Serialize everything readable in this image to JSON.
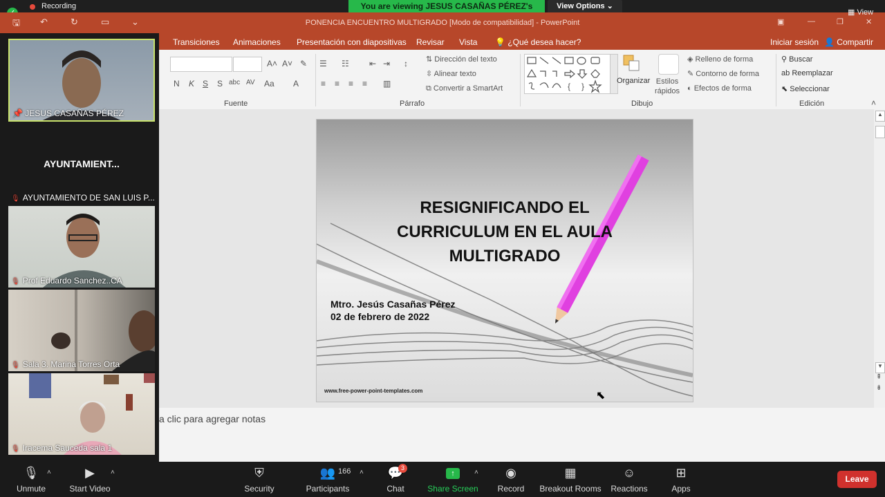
{
  "zoom": {
    "recording_label": "Recording",
    "viewing_banner": "You are viewing JESUS CASAÑAS PÉREZ's screen",
    "view_options": "View Options",
    "view_button": "View",
    "participants": [
      {
        "name": "JESUS CASAÑAS PÉREZ",
        "pinned": true
      },
      {
        "name": "AYUNTAMIENTO DE SAN LUIS P...",
        "center_label": "AYUNTAMIENT..."
      },
      {
        "name": "Prof Eduardo Sanchez..CA"
      },
      {
        "name": "Sala 3. Marina Torres Orta"
      },
      {
        "name": "Iracema Sauceda sala 1"
      }
    ],
    "toolbar": {
      "unmute": "Unmute",
      "start_video": "Start Video",
      "security": "Security",
      "participants": "Participants",
      "participants_count": "166",
      "chat": "Chat",
      "chat_badge": "3",
      "share_screen": "Share Screen",
      "record": "Record",
      "breakout_rooms": "Breakout Rooms",
      "reactions": "Reactions",
      "apps": "Apps",
      "leave": "Leave"
    }
  },
  "powerpoint": {
    "window_title": "PONENCIA ENCUENTRO MULTIGRADO [Modo de compatibilidad] - PowerPoint",
    "sign_in": "Iniciar sesión",
    "share": "Compartir",
    "tabs": [
      "Transiciones",
      "Animaciones",
      "Presentación con diapositivas",
      "Revisar",
      "Vista",
      "¿Qué desea hacer?"
    ],
    "ribbon": {
      "fuente_label": "Fuente",
      "parrafo_label": "Párrafo",
      "dibujo_label": "Dibujo",
      "edicion_label": "Edición",
      "direccion_texto": "Dirección del texto",
      "alinear_texto": "Alinear texto",
      "convertir_smartart": "Convertir a SmartArt",
      "organizar": "Organizar",
      "estilos_rapidos": "Estilos rápidos",
      "relleno_forma": "Relleno de forma",
      "contorno_forma": "Contorno de forma",
      "efectos_forma": "Efectos de forma",
      "buscar": "Buscar",
      "reemplazar": "Reemplazar",
      "seleccionar": "Seleccionar",
      "font_buttons": [
        "N",
        "K",
        "S",
        "S",
        "abc",
        "AV",
        "Aa",
        "A"
      ]
    },
    "slide": {
      "title_lines": [
        "RESIGNIFICANDO EL",
        "CURRICULUM EN EL AULA",
        "MULTIGRADO"
      ],
      "author": "Mtro. Jesús Casañas Pérez",
      "date": "02 de febrero  de 2022",
      "url": "www.free-power-point-templates.com"
    },
    "notes_placeholder": "a clic para agregar notas"
  },
  "colors": {
    "ppt_red": "#b7472a",
    "zoom_green": "#27b84a",
    "leave_red": "#d0312d",
    "pencil_magenta": "#e040e0"
  }
}
